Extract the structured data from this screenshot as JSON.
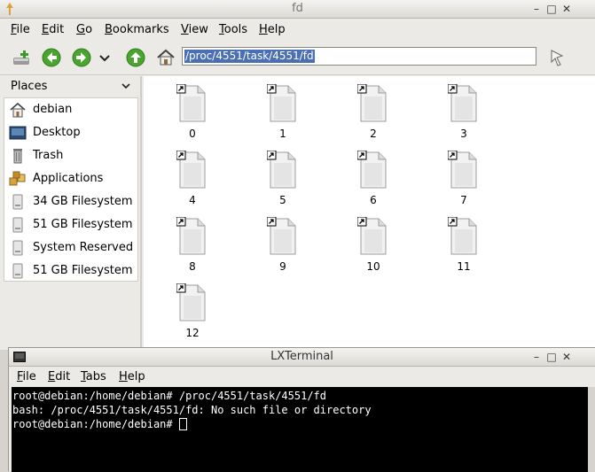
{
  "file_manager": {
    "title": "fd",
    "menu": [
      "File",
      "Edit",
      "Go",
      "Bookmarks",
      "View",
      "Tools",
      "Help"
    ],
    "menu_mnemonics": [
      "F",
      "E",
      "G",
      "B",
      "V",
      "T",
      "H"
    ],
    "address": "/proc/4551/task/4551/fd",
    "sidebar": {
      "header": "Places",
      "items": [
        {
          "label": "debian",
          "icon": "home-icon"
        },
        {
          "label": "Desktop",
          "icon": "desktop-icon"
        },
        {
          "label": "Trash",
          "icon": "trash-icon"
        },
        {
          "label": "Applications",
          "icon": "applications-icon"
        },
        {
          "label": "34 GB Filesystem",
          "icon": "drive-icon"
        },
        {
          "label": "51 GB Filesystem",
          "icon": "drive-icon"
        },
        {
          "label": "System Reserved",
          "icon": "drive-icon"
        },
        {
          "label": "51 GB Filesystem",
          "icon": "drive-icon"
        }
      ]
    },
    "files": [
      "0",
      "1",
      "2",
      "3",
      "4",
      "5",
      "6",
      "7",
      "8",
      "9",
      "10",
      "11",
      "12"
    ]
  },
  "terminal": {
    "title": "LXTerminal",
    "menu": [
      "File",
      "Edit",
      "Tabs",
      "Help"
    ],
    "menu_mnemonics": [
      "F",
      "E",
      "T",
      "H"
    ],
    "lines": [
      "root@debian:/home/debian# /proc/4551/task/4551/fd",
      "bash: /proc/4551/task/4551/fd: No such file or directory",
      "root@debian:/home/debian# "
    ]
  },
  "colors": {
    "selection": "#4a6fb5",
    "terminal_bg": "#000000",
    "terminal_fg": "#ffffff"
  }
}
